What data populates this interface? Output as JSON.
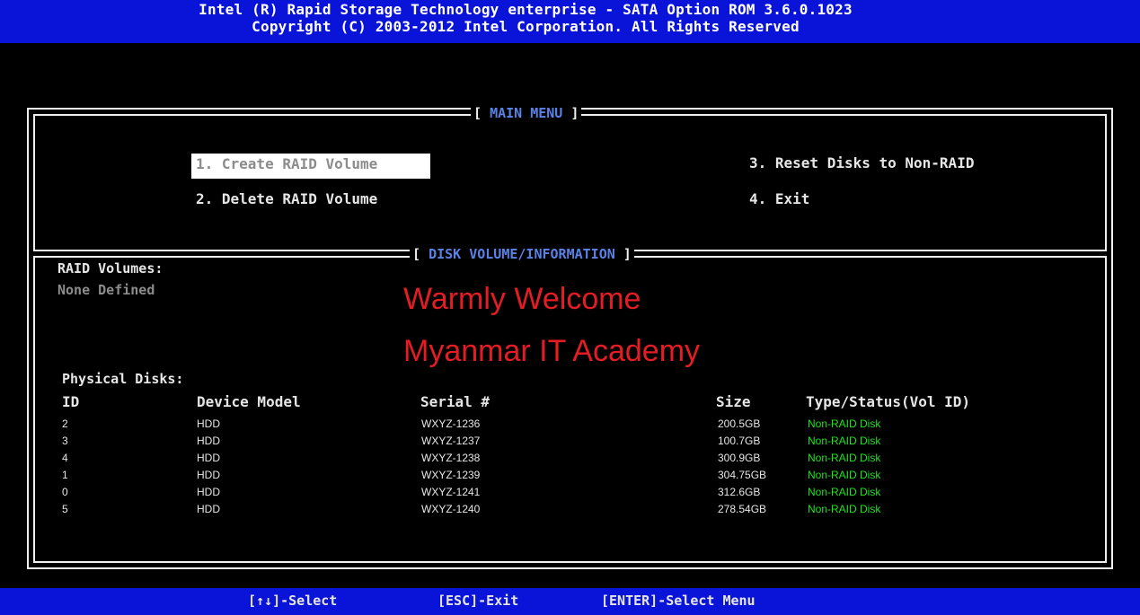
{
  "header": {
    "line1": "Intel (R) Rapid Storage Technology enterprise - SATA Option ROM 3.6.0.1023",
    "line2": "Copyright (C) 2003-2012 Intel Corporation. All Rights Reserved"
  },
  "main_menu": {
    "title": "MAIN MENU",
    "items": [
      {
        "label": "1. Create RAID Volume",
        "selected": true
      },
      {
        "label": "2. Delete RAID Volume",
        "selected": false
      },
      {
        "label": "3. Reset Disks to Non-RAID",
        "selected": false
      },
      {
        "label": "4. Exit",
        "selected": false
      }
    ]
  },
  "disk_info": {
    "title": "DISK VOLUME/INFORMATION",
    "raid_volumes_label": "RAID Volumes:",
    "raid_volumes_value": "None Defined",
    "physical_disks_label": "Physical Disks:",
    "columns": [
      "ID",
      "Device Model",
      "Serial #",
      "Size",
      "Type/Status(Vol ID)"
    ],
    "rows": [
      {
        "id": "2",
        "model": "HDD",
        "serial": "WXYZ-1236",
        "size": "200.5GB",
        "status": "Non-RAID Disk"
      },
      {
        "id": "3",
        "model": "HDD",
        "serial": "WXYZ-1237",
        "size": "100.7GB",
        "status": "Non-RAID Disk"
      },
      {
        "id": "4",
        "model": "HDD",
        "serial": "WXYZ-1238",
        "size": "300.9GB",
        "status": "Non-RAID Disk"
      },
      {
        "id": "1",
        "model": "HDD",
        "serial": "WXYZ-1239",
        "size": "304.75GB",
        "status": "Non-RAID Disk"
      },
      {
        "id": "0",
        "model": "HDD",
        "serial": "WXYZ-1241",
        "size": "312.6GB",
        "status": "Non-RAID Disk"
      },
      {
        "id": "5",
        "model": "HDD",
        "serial": "WXYZ-1240",
        "size": "278.54GB",
        "status": "Non-RAID Disk"
      }
    ]
  },
  "overlay": {
    "line1": "Warmly Welcome",
    "line2": "Myanmar IT Academy"
  },
  "footer": {
    "select_hint": "[↑↓]-Select",
    "exit_hint": "[ESC]-Exit",
    "enter_hint": "[ENTER]-Select Menu"
  },
  "colors": {
    "bar_blue": "#0a14d8",
    "title_blue": "#5a82e6",
    "status_green": "#20e020",
    "overlay_red": "#e41c24"
  }
}
